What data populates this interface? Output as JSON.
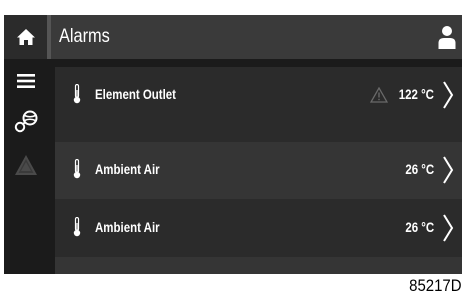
{
  "header": {
    "title": "Alarms"
  },
  "sidebar": {
    "items": [
      {
        "icon": "home-icon"
      },
      {
        "icon": "menu-icon"
      },
      {
        "icon": "compressor-icon"
      },
      {
        "icon": "warning-icon"
      }
    ]
  },
  "alarms": [
    {
      "label": "Element Outlet",
      "value": "122 °C",
      "warning": true,
      "icon": "thermometer-icon"
    },
    {
      "label": "Ambient Air",
      "value": "26 °C",
      "warning": false,
      "icon": "thermometer-icon"
    },
    {
      "label": "Ambient Air",
      "value": "26 °C",
      "warning": false,
      "icon": "thermometer-icon"
    }
  ],
  "figure_id": "85217D",
  "colors": {
    "background": "#1b1b1b",
    "header": "#3a3a3a",
    "row_dark": "#2b2b2b",
    "row_light": "#353535",
    "text": "#ffffff",
    "inactive_icon": "#4a4a4a"
  }
}
